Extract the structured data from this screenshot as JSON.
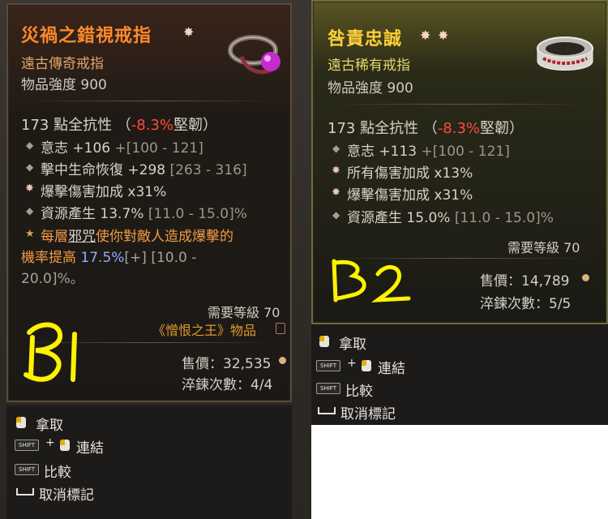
{
  "left": {
    "title": "災禍之錯視戒指",
    "rarity": "遠古傳奇戒指",
    "power": "物品強度 900",
    "main_stat": {
      "prefix": "173 點全抗性 （",
      "neg": "-8.3%",
      "suffix": "堅韌）"
    },
    "stats": [
      {
        "text": "意志 +106 ",
        "range": "+[100 - 121]"
      },
      {
        "text": "擊中生命恢復 +298 ",
        "range": "[263 - 316]"
      },
      {
        "text": "爆擊傷害加成 x31%",
        "range": ""
      },
      {
        "text": "資源產生 13.7% ",
        "range": "[11.0 - 15.0]%"
      }
    ],
    "legendary": {
      "part1": "每層",
      "underlined": "邪咒",
      "part2": "使你對敵人造成爆擊的",
      "line2": "機率提高 ",
      "blue": "17.5%",
      "grey": "[+] [10.0 -",
      "line3": "20.0]%。"
    },
    "requirement": "需要等級 70",
    "tag": "《憎恨之王》物品",
    "price_label": "售價：32,535",
    "temper_label": "淬鍊次數：4/4",
    "annotation": "B1"
  },
  "right": {
    "title": "咎責忠誠",
    "rarity": "遠古稀有戒指",
    "power": "物品強度 900",
    "main_stat": {
      "prefix": "173 點全抗性 （",
      "neg": "-8.3%",
      "suffix": "堅韌）"
    },
    "stats": [
      {
        "text": "意志 +113 ",
        "range": "+[100 - 121]"
      },
      {
        "text": "所有傷害加成 x13%",
        "range": ""
      },
      {
        "text": "爆擊傷害加成 x31%",
        "range": ""
      },
      {
        "text": "資源產生 15.0% ",
        "range": "[11.0 - 15.0]%"
      }
    ],
    "requirement": "需要等級 70",
    "price_label": "售價：14,789",
    "temper_label": "淬鍊次數：5/5",
    "annotation": "B2"
  },
  "actions": {
    "pickup": "拿取",
    "link": "連結",
    "compare": "比較",
    "unmark": "取消標記",
    "shift_key": "SHIFT",
    "plus": "+"
  }
}
